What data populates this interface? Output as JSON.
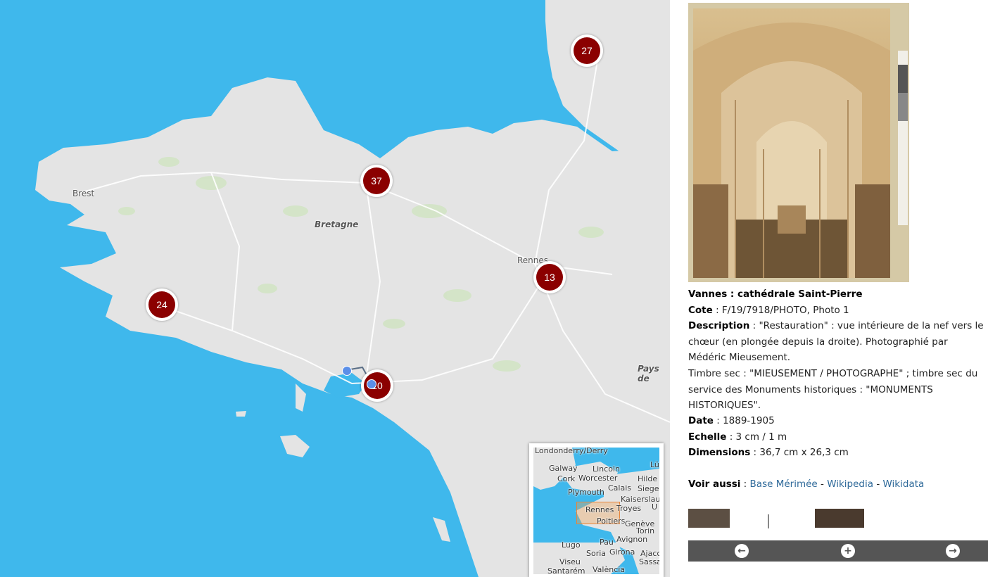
{
  "map": {
    "places": [
      {
        "name": "Brest",
        "type": "city"
      },
      {
        "name": "Bretagne",
        "type": "region"
      },
      {
        "name": "Rennes",
        "type": "city"
      },
      {
        "name": "Pays de",
        "type": "region"
      }
    ],
    "clusters": [
      "27",
      "37",
      "13",
      "24",
      "10"
    ],
    "minimap": {
      "labels": [
        "Londonderry/Derry",
        "Galway",
        "Lincoln",
        "Cork",
        "Worcester",
        "Hilde",
        "Plymouth",
        "Calais",
        "Siege",
        "Kaiserslau",
        "Rennes",
        "Troyes",
        "Poitiers",
        "Genève",
        "Pau",
        "Avignon",
        "Lugo",
        "Torin",
        "Soria",
        "Girona",
        "Ajacc",
        "Viseu",
        "Sassa",
        "Santarém",
        "València",
        "Lü",
        "U"
      ]
    }
  },
  "record": {
    "title": "Vannes : cathédrale Saint-Pierre",
    "cote_label": "Cote",
    "cote_value": " : F/19/7918/PHOTO, Photo 1",
    "description_label": "Description",
    "description_value": " : \"Restauration\" : vue intérieure de la nef vers le chœur (en plongée depuis la droite). Photographié par Médéric Mieusement.",
    "timbre": "Timbre sec : \"MIEUSEMENT / PHOTOGRAPHE\" ; timbre sec du service des Monuments historiques : \"MONUMENTS HISTORIQUES\".",
    "date_label": "Date",
    "date_value": " : 1889-1905",
    "echelle_label": "Echelle",
    "echelle_value": " : 3 cm / 1 m",
    "dimensions_label": "Dimensions",
    "dimensions_value": " : 36,7 cm x 26,3 cm",
    "voir_label": "Voir aussi",
    "voir_sep1": " : ",
    "link_merimee": "Base Mérimée",
    "sep": " - ",
    "link_wikipedia": "Wikipedia",
    "link_wikidata": "Wikidata"
  },
  "nav": {
    "prev": "←",
    "add": "+",
    "next": "→"
  },
  "colors": {
    "sea": "#3fb8ec",
    "land": "#e4e4e4",
    "cluster": "#8b0000",
    "link": "#2f6a9a",
    "navbar": "#555555"
  }
}
